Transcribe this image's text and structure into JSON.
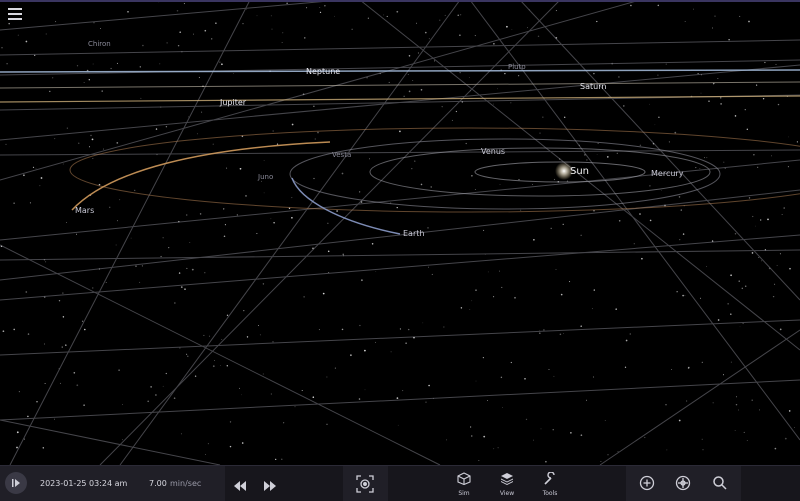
{
  "app": {
    "menu_icon": "hamburger-menu-icon"
  },
  "bodies": {
    "sun": "Sun",
    "mercury": "Mercury",
    "venus": "Venus",
    "earth": "Earth",
    "mars": "Mars",
    "vesta": "Vesta",
    "juno": "Juno",
    "jupiter": "Jupiter",
    "saturn": "Saturn",
    "neptune": "Neptune",
    "chiron": "Chiron",
    "pluto": "Pluto"
  },
  "footer": {
    "datetime": "2023-01-25 03:24 am",
    "rate_value": "7.00",
    "rate_unit": "min/sec",
    "tools": {
      "sim": "Sim",
      "view": "View",
      "tools": "Tools"
    }
  },
  "colors": {
    "orbit_gray": "#8c8c96",
    "mars_orbit": "#c08a5a",
    "jupiter_orbit": "#d8b880",
    "neptune_orbit": "#9cb4d8",
    "earth_orbit": "#8a9ac8",
    "panel_bg": "#17161c"
  }
}
